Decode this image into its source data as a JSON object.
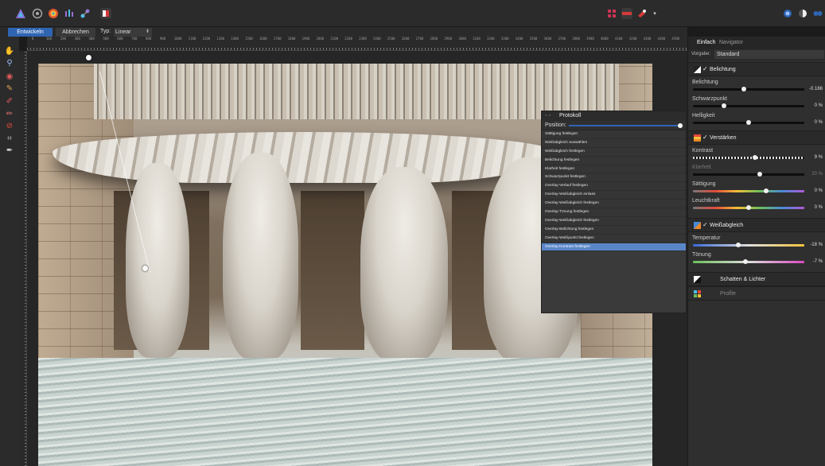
{
  "toolbar": {
    "personas": [
      "affinity-logo",
      "liquify-persona",
      "develop-persona",
      "tone-mapping-persona",
      "export-persona"
    ],
    "right_icons": [
      "grid-icon",
      "split-view-icon",
      "red-eye-icon",
      "dropdown-arrow-icon"
    ]
  },
  "context": {
    "develop_label": "Entwickeln",
    "cancel_label": "Abbrechen",
    "type_label": "Typ:",
    "type_value": "Linear"
  },
  "ruler": {
    "ticks": [
      "0",
      "100",
      "200",
      "300",
      "400",
      "500",
      "600",
      "700",
      "800",
      "900",
      "1000",
      "1100",
      "1200",
      "1300",
      "1400",
      "1500",
      "1600",
      "1700",
      "1800",
      "1900",
      "2000",
      "2100",
      "2200",
      "2300",
      "2400",
      "2500",
      "2600",
      "2700",
      "2800",
      "2900",
      "3000",
      "3100",
      "3200",
      "3300",
      "3400",
      "3500",
      "3600",
      "3700",
      "3800",
      "3900",
      "4000",
      "4100",
      "4200",
      "4300",
      "4400",
      "4500"
    ]
  },
  "history": {
    "title": "Protokoll",
    "position_label": "Position:",
    "items": [
      "Sättigung festlegen",
      "Weißabgleich auswählen",
      "Weißabgleich festlegen",
      "Belichtung festlegen",
      "Klarheit festlegen",
      "Schwarzpunkt festlegen",
      "Overlay-Verlauf festlegen",
      "Overlay-Weißabgleich einlass",
      "Overlay-Weißabgleich festlegen",
      "Overlay-Tönung festlegen",
      "Overlay-Weißabgleich festlegen",
      "Overlay-Belichtung festlegen",
      "Overlay-Weißpunkt festlegen",
      "Overlay-Kontrast festlegen"
    ],
    "selected_index": 13
  },
  "panel": {
    "tab_basic": "Einfach",
    "tab_navigator": "Navigator",
    "preset_label": "Vorgabe:",
    "preset_value": "Standard",
    "exposure": {
      "title": "Belichtung",
      "rows": [
        {
          "label": "Belichtung",
          "value": "-0.166",
          "pos": 0.46
        },
        {
          "label": "Schwarzpunkt",
          "value": "0 %",
          "pos": 0.28
        },
        {
          "label": "Helligkeit",
          "value": "0 %",
          "pos": 0.5
        }
      ]
    },
    "enhance": {
      "title": "Verstärken",
      "rows": [
        {
          "label": "Kontrast",
          "value": "9 %",
          "pos": 0.56
        },
        {
          "label": "Klarheit",
          "value": "20 %",
          "pos": 0.6
        },
        {
          "label": "Sättigung",
          "value": "0 %",
          "pos": 0.66
        },
        {
          "label": "Leuchtkraft",
          "value": "0 %",
          "pos": 0.5
        }
      ]
    },
    "white_balance": {
      "title": "Weißabgleich",
      "rows": [
        {
          "label": "Temperatur",
          "value": "-18 %",
          "pos": 0.41
        },
        {
          "label": "Tönung",
          "value": "-7 %",
          "pos": 0.47
        }
      ]
    },
    "shadows_title": "Schatten & Lichter",
    "profile_title": "Profile"
  },
  "colors": {
    "accent": "#2f64b3",
    "selection": "#5a86c9"
  }
}
